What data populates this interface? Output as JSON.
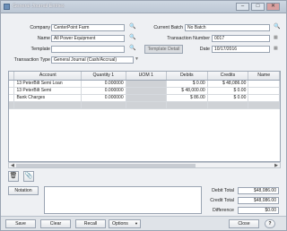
{
  "window": {
    "title": "General Journal Entries",
    "buttons": [
      "–",
      "□",
      "✕"
    ]
  },
  "form": {
    "company_label": "Company",
    "company_value": "CenterPoint Farm",
    "name_label": "Name",
    "name_value": "All Power Equipment",
    "template_label": "Template",
    "template_value": "",
    "template_detail_button": "Template Detail",
    "transaction_type_label": "Transaction Type",
    "transaction_type_value": "General Journal (Cash/Accrual)",
    "current_batch_label": "Current Batch",
    "current_batch_value": "No Batch",
    "transaction_number_label": "Transaction Number",
    "transaction_number_value": "0017",
    "date_label": "Date",
    "date_value": "10/17/2016"
  },
  "grid": {
    "columns": [
      "Account",
      "Quantity 1",
      "UOM 1",
      "Debits",
      "Credits",
      "Name"
    ],
    "rows": [
      {
        "account": "13 PeterBilt Semi Loan",
        "quantity": "0.000000",
        "uom": "",
        "debits": "$ 0.00",
        "credits": "$ 48,086.00",
        "name": ""
      },
      {
        "account": "13 PeterBilt Semi",
        "quantity": "0.000000",
        "uom": "",
        "debits": "$ 48,000.00",
        "credits": "$ 0.00",
        "name": ""
      },
      {
        "account": "Bank Charges",
        "quantity": "0.000000",
        "uom": "",
        "debits": "$ 86.00",
        "credits": "$ 0.00",
        "name": ""
      }
    ]
  },
  "notation_button": "Notation",
  "totals": {
    "debit_label": "Debit Total",
    "debit_value": "$48,086.00",
    "credit_label": "Credit Total",
    "credit_value": "$48,086.00",
    "difference_label": "Difference",
    "difference_value": "$0.00"
  },
  "footer": {
    "save": "Save",
    "clear": "Clear",
    "recall": "Recall",
    "options": "Options",
    "close": "Close"
  }
}
